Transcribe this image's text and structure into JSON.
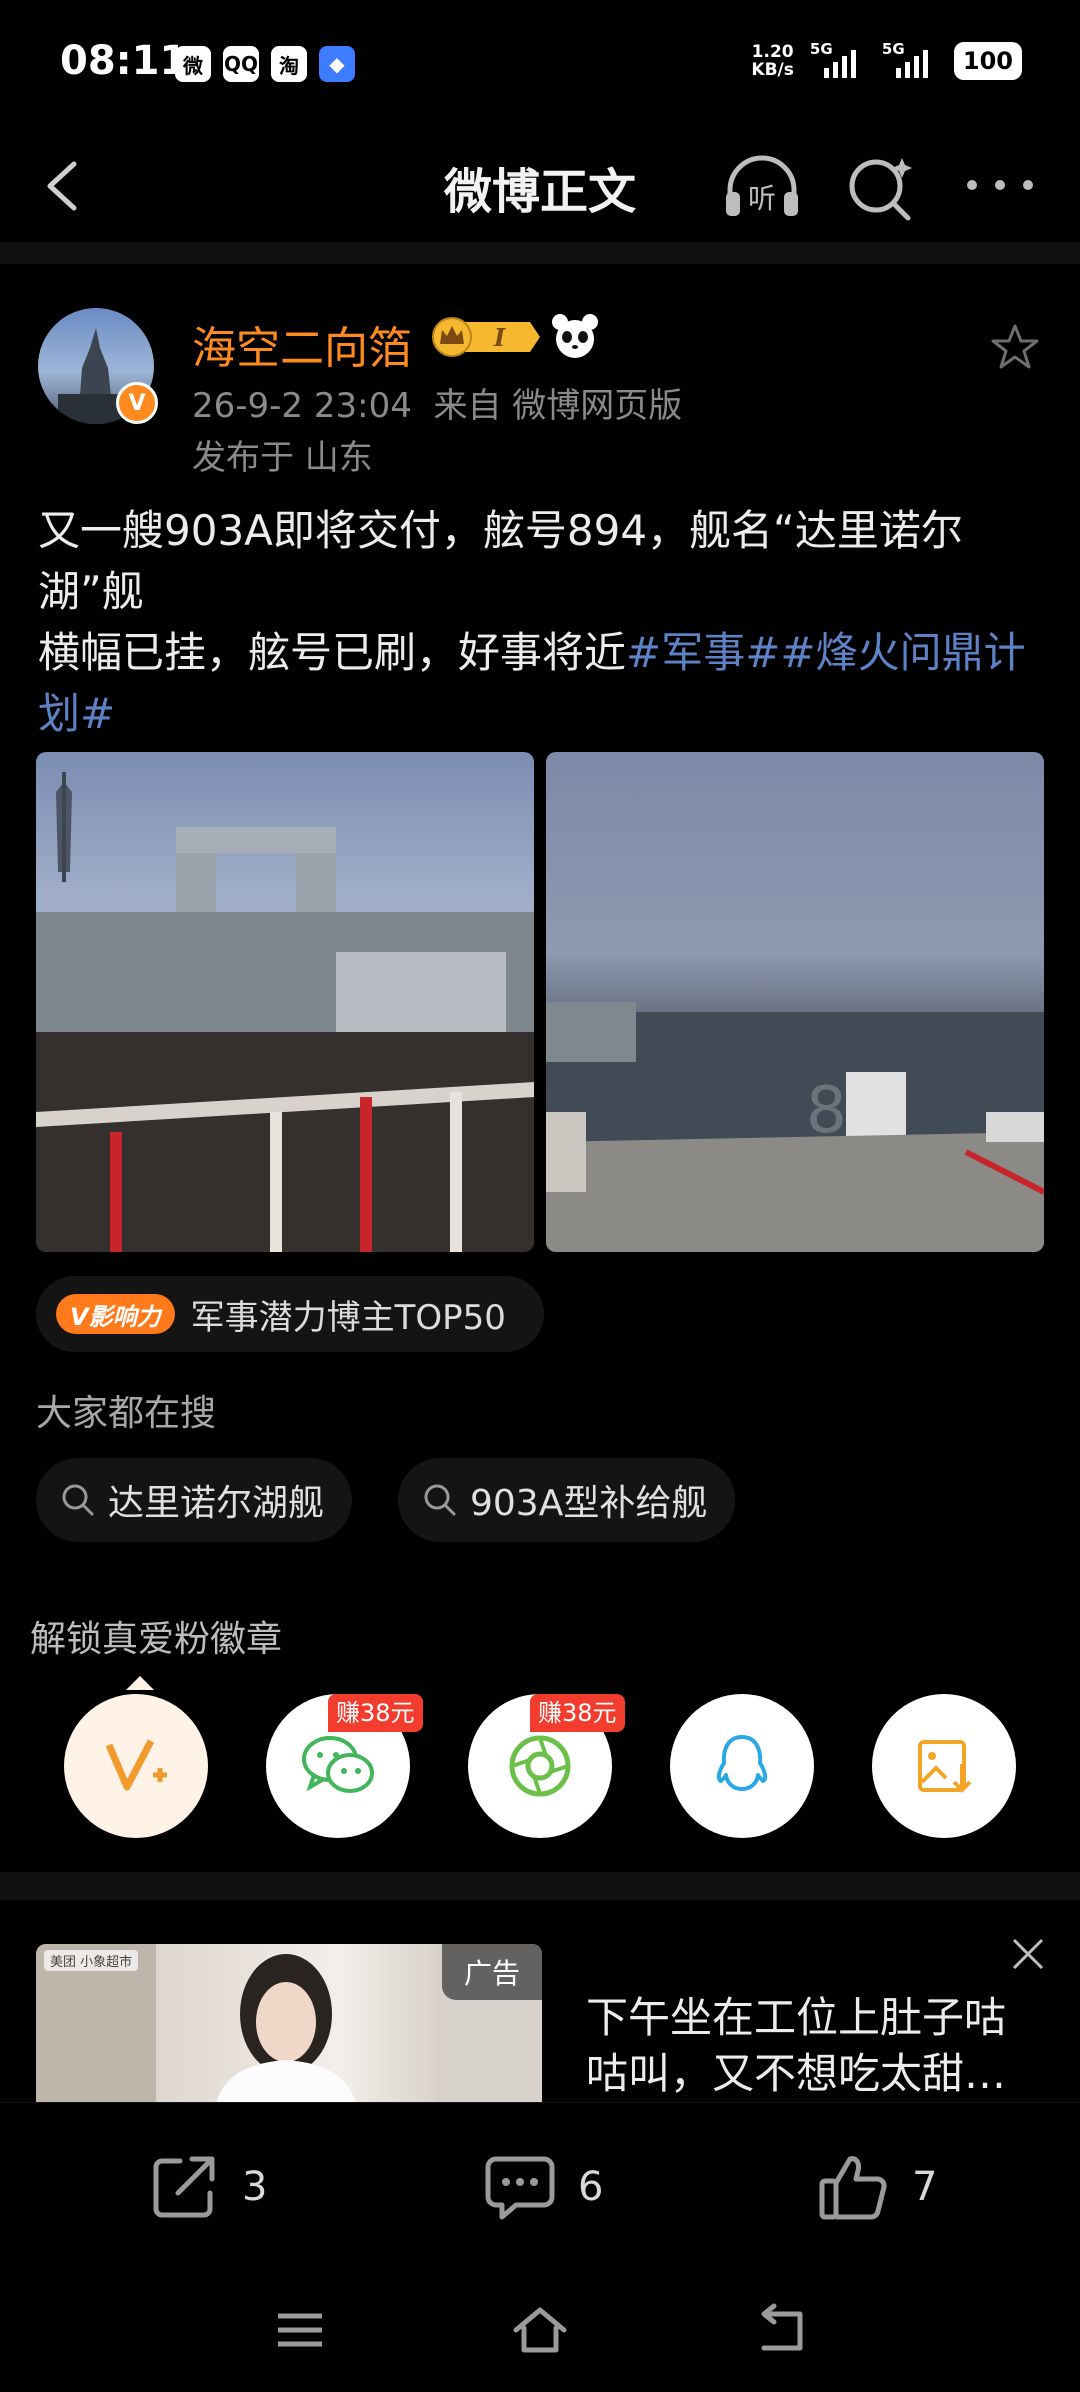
{
  "status_bar": {
    "time": "08:11",
    "apps": [
      "微",
      "QQ",
      "淘",
      "◆"
    ],
    "net_speed_value": "1.20",
    "net_speed_unit": "KB/s",
    "signal1": "5G",
    "signal2": "5G",
    "battery": "100"
  },
  "header": {
    "title": "微博正文"
  },
  "post": {
    "author": "海空二向箔",
    "verified_mark": "V",
    "time": "26-9-2 23:04",
    "source": "来自 微博网页版",
    "location": "发布于 山东",
    "text_line1": "又一艘903A即将交付，舷号894，舰名“达里诺尔湖”舰",
    "text_line2": "横幅已挂，舷号已刷，好事将近",
    "hashtag1": "#军事#",
    "hashtag2": "#烽火问鼎计划#"
  },
  "influence": {
    "badge": "V影响力",
    "label": "军事潜力博主TOP50"
  },
  "search": {
    "heading": "大家都在搜",
    "items": [
      "达里诺尔湖舰",
      "903A型补给舰"
    ]
  },
  "unlock": {
    "heading": "解锁真爱粉徽章",
    "reward1": "赚38元",
    "reward2": "赚38元"
  },
  "ad": {
    "tag": "广告",
    "brand": "美团 小象超市",
    "title": "下午坐在工位上肚子咕咕叫，又不想吃太甜…"
  },
  "actions": {
    "share_count": "3",
    "comment_count": "6",
    "like_count": "7"
  }
}
